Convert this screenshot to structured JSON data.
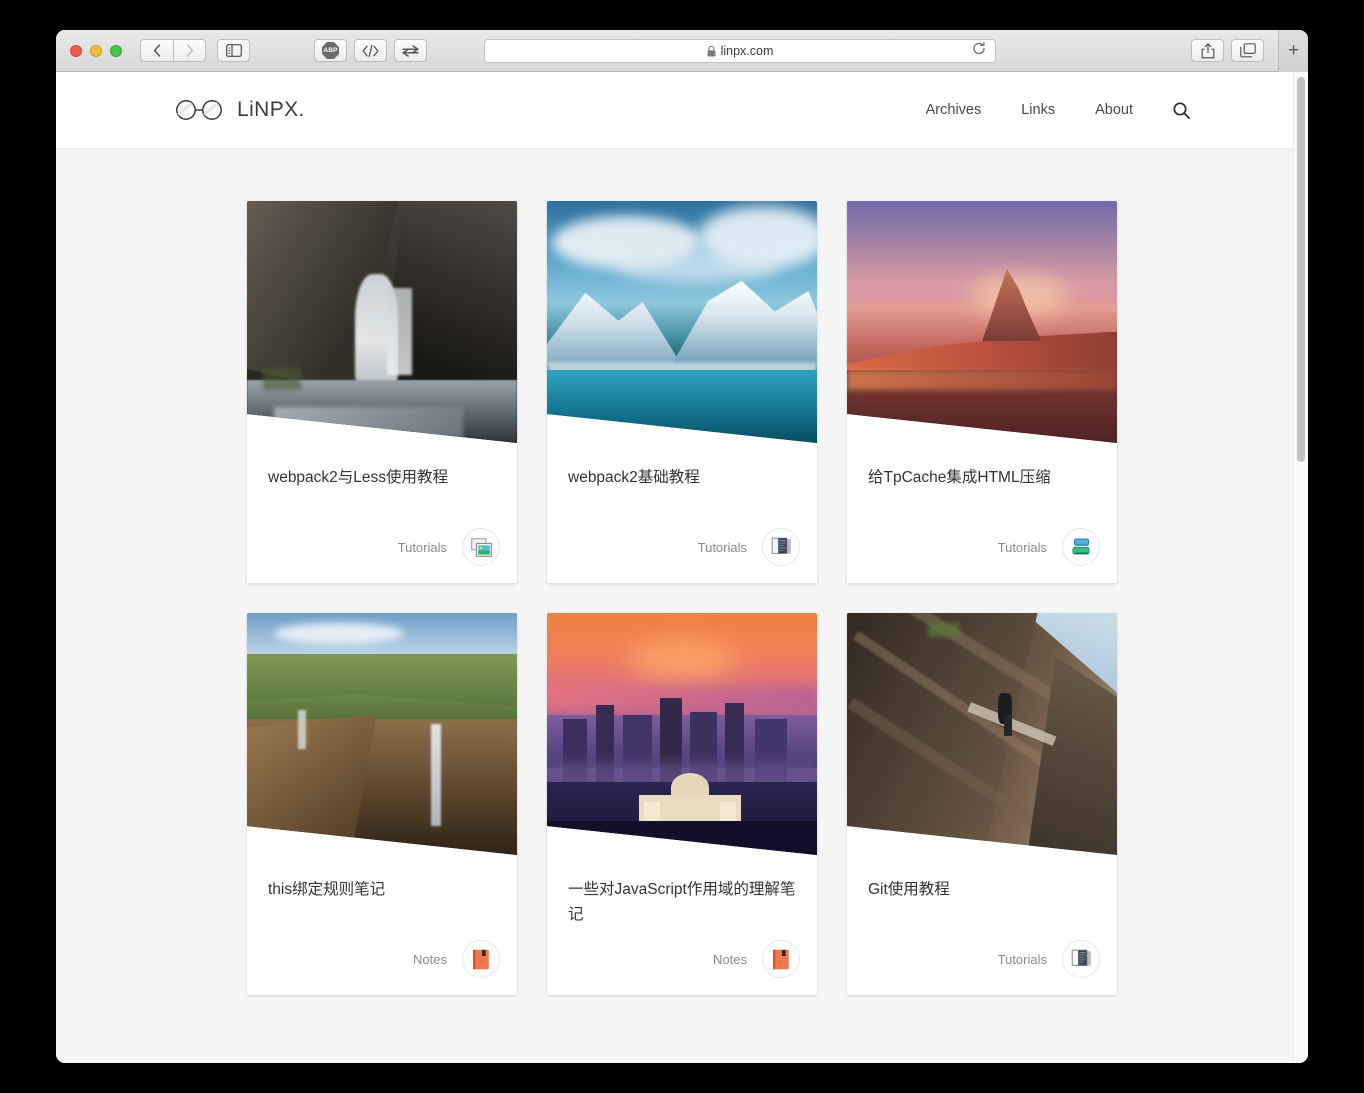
{
  "browser": {
    "window_controls": [
      "close",
      "minimize",
      "maximize"
    ],
    "nav_back_label": "Back",
    "nav_forward_label": "Forward",
    "sidebar_label": "Show Sidebar",
    "extensions": [
      {
        "name": "adblock-plus",
        "label": "ABP"
      },
      {
        "name": "developer-tools",
        "label": "</>"
      },
      {
        "name": "switch-tabs",
        "label": "arrows"
      }
    ],
    "address": {
      "url": "linpx.com",
      "secure": true,
      "reload_label": "Reload"
    },
    "share_label": "Share",
    "tab_overview_label": "Show Tab Overview",
    "new_tab_label": "+"
  },
  "site": {
    "brand": {
      "logo_icon": "glasses-icon",
      "name": "LiNPX."
    },
    "nav": [
      {
        "id": "archives",
        "label": "Archives"
      },
      {
        "id": "links",
        "label": "Links"
      },
      {
        "id": "about",
        "label": "About"
      }
    ],
    "search_label": "Search"
  },
  "cards": [
    {
      "id": "webpack2-less",
      "title": "webpack2与Less使用教程",
      "category": "Tutorials",
      "icon": "photos-window-icon",
      "thumb": "waterfall-canyon-photo"
    },
    {
      "id": "webpack2-basic",
      "title": "webpack2基础教程",
      "category": "Tutorials",
      "icon": "dark-window-icon",
      "thumb": "snow-mountain-lake-photo"
    },
    {
      "id": "tpcache-html",
      "title": "给TpCache集成HTML压缩",
      "category": "Tutorials",
      "icon": "stacked-servers-icon",
      "thumb": "desert-sunset-mesa-photo"
    },
    {
      "id": "this-binding",
      "title": "this绑定规则笔记",
      "category": "Notes",
      "icon": "orange-notebook-icon",
      "thumb": "green-canyon-waterfall-photo"
    },
    {
      "id": "js-scope",
      "title": "一些对JavaScript作用域的理解笔记",
      "category": "Notes",
      "icon": "orange-notebook-icon",
      "thumb": "city-sunset-skyline-photo"
    },
    {
      "id": "git-tutorial",
      "title": "Git使用教程",
      "category": "Tutorials",
      "icon": "dark-window-icon",
      "thumb": "rock-climber-cliff-photo"
    }
  ],
  "colors": {
    "page_background": "#f5f5f5",
    "card_background": "#ffffff",
    "title_text": "#333333",
    "category_text": "#8b8b8b",
    "nav_text": "#4a4a4a",
    "brand_text": "#3c3c3c"
  },
  "scrollbar": {
    "position_label": "top"
  }
}
